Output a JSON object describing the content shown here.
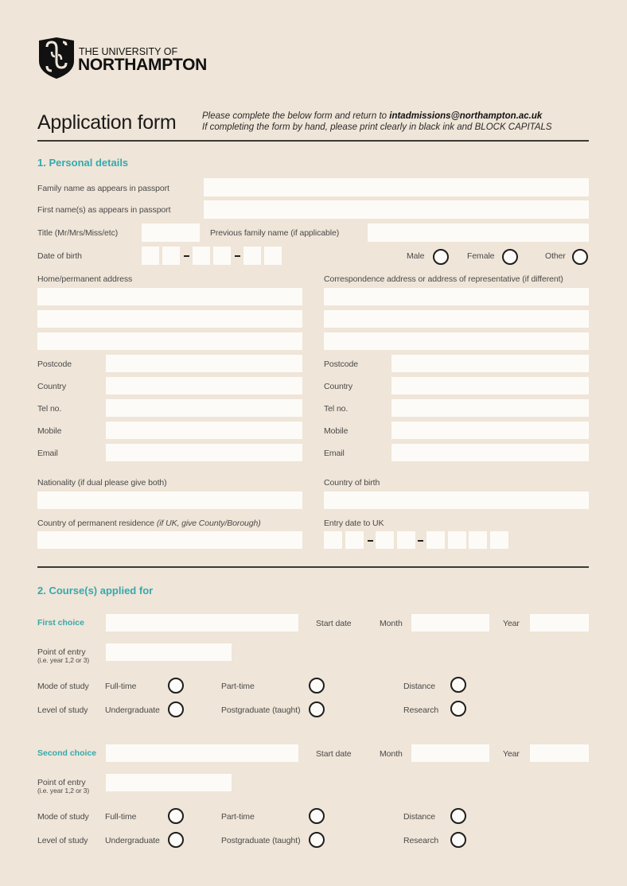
{
  "header": {
    "university_line1": "THE UNIVERSITY OF",
    "university_line2": "NORTHAMPTON",
    "form_title": "Application form",
    "instruction_line1_prefix": "Please complete the below form and return to ",
    "instruction_email": "intadmissions@northampton.ac.uk",
    "instruction_line2": "If completing the form by hand, please print clearly in black ink and BLOCK CAPITALS"
  },
  "colors": {
    "background": "#efe5d8",
    "accent": "#35a9ad",
    "field": "#fdfbf7",
    "text": "#3a3a3a"
  },
  "personal": {
    "title": "1. Personal details",
    "family_name_label": "Family name as appears in passport",
    "first_name_label": "First name(s) as appears in passport",
    "title_label": "Title (Mr/Mrs/Miss/etc)",
    "previous_name_label": "Previous family name (if applicable)",
    "dob_label": "Date of birth",
    "gender_options": [
      "Male",
      "Female",
      "Other"
    ],
    "home_address_label": "Home/permanent address",
    "corr_address_label": "Correspondence address or address of representative (if different)",
    "contact_labels": [
      "Postcode",
      "Country",
      "Tel no.",
      "Mobile",
      "Email"
    ],
    "nationality_label": "Nationality (if dual please give both)",
    "country_birth_label": "Country of birth",
    "residence_label": "Country of permanent residence ",
    "residence_label_italic": "(if UK, give County/Borough)",
    "entry_date_label": "Entry date to UK"
  },
  "courses": {
    "title": "2. Course(s) applied for",
    "start_date_label": "Start date",
    "month_label": "Month",
    "year_label": "Year",
    "point_of_entry_label": "Point of entry",
    "point_of_entry_hint": "(i.e. year 1,2 or 3)",
    "mode_label": "Mode of study",
    "level_label": "Level of study",
    "mode_options": [
      "Full-time",
      "Part-time",
      "Distance"
    ],
    "level_options": [
      "Undergraduate",
      "Postgraduate (taught)",
      "Research"
    ],
    "choices": [
      {
        "label": "First choice"
      },
      {
        "label": "Second choice"
      }
    ]
  }
}
